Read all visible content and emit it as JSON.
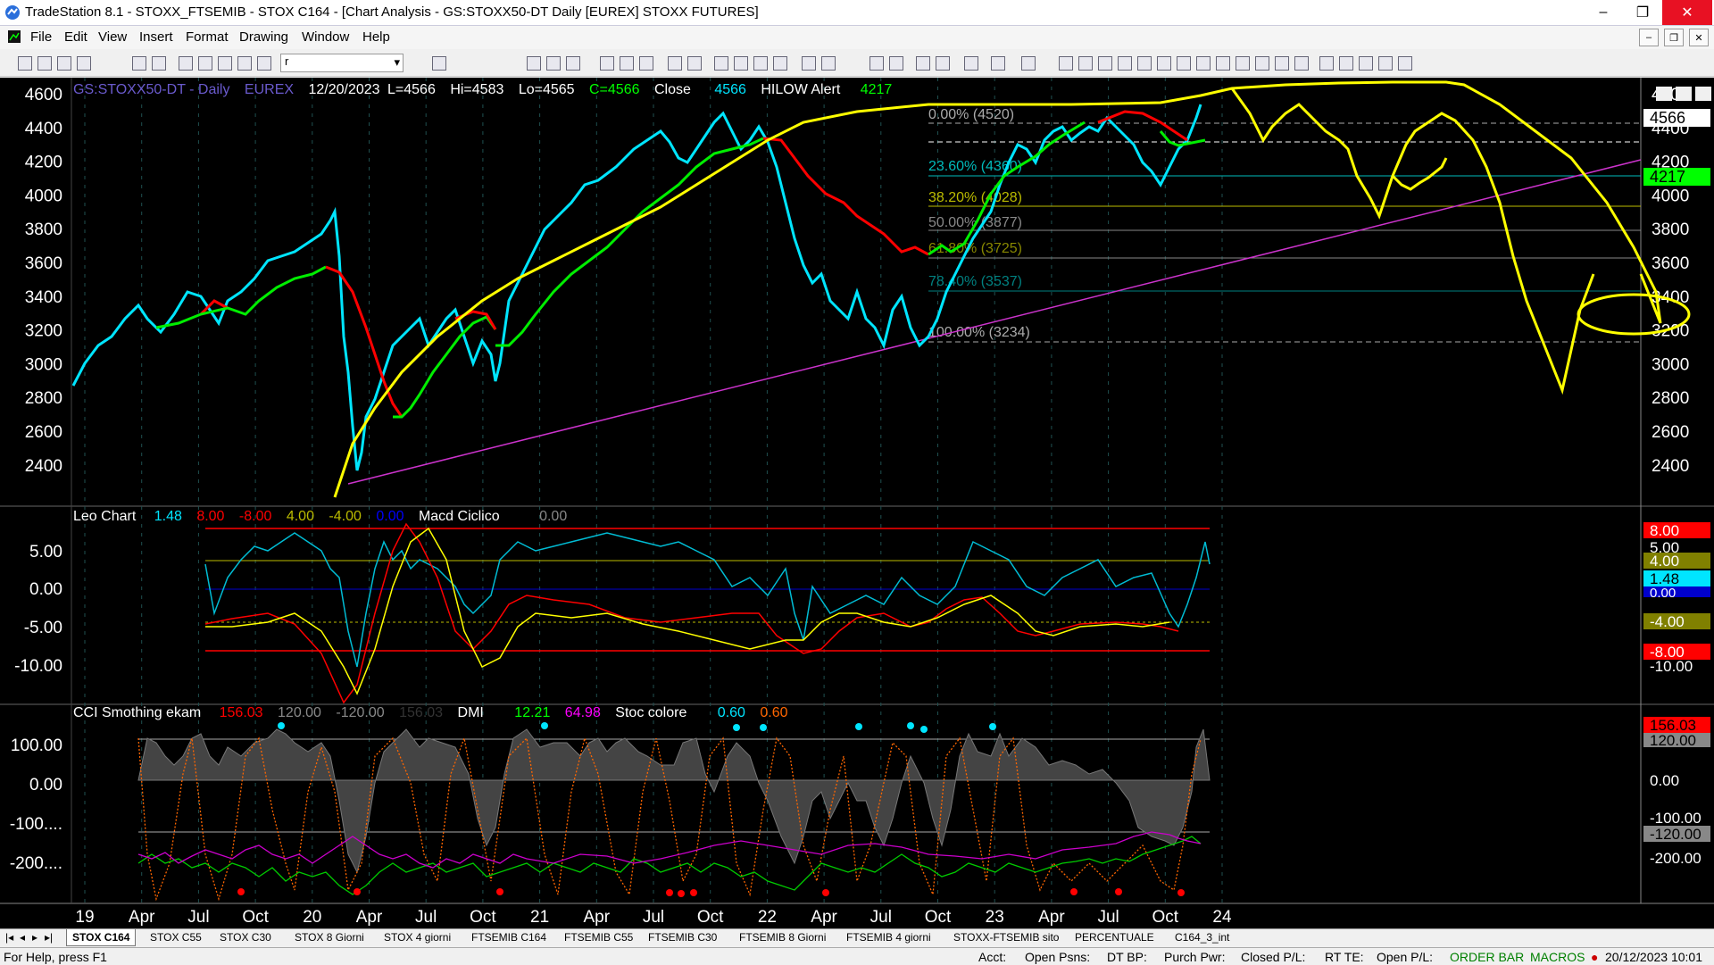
{
  "window": {
    "title": "TradeStation 8.1 - STOXX_FTSEMIB - STOX C164 - [Chart Analysis - GS:STOXX50-DT  Daily  [EUREX] STOXX FUTURES]",
    "minimize": "–",
    "maximize": "❐",
    "close": "✕"
  },
  "menu": [
    "File",
    "Edit",
    "View",
    "Insert",
    "Format",
    "Drawing",
    "Window",
    "Help"
  ],
  "mdi": [
    "–",
    "❐",
    "✕"
  ],
  "toolbar": {
    "symbol_box": "r"
  },
  "chart": {
    "header": {
      "symbol": "GS:STOXX50-DT - Daily",
      "exchange": "EUREX",
      "date": "12/20/2023",
      "last": "L=4566",
      "high": "Hi=4583",
      "low": "Lo=4565",
      "close": "C=4566",
      "close_label": "Close",
      "close_value": "4566",
      "ind_name": "HILOW Alert",
      "ind_value": "4217"
    },
    "price_ticks": [
      "4600",
      "4400",
      "4200",
      "4000",
      "3800",
      "3600",
      "3400",
      "3200",
      "3000",
      "2800",
      "2600",
      "2400"
    ],
    "price_tags": {
      "last": "4566",
      "hilow": "4217"
    },
    "fib_labels": [
      "0.00% (4520)",
      "23.60% (4360)",
      "38.20% (4028)",
      "50.00% (3877)",
      "61.80% (3725)",
      "78.40% (3537)",
      "100.00% (3234)"
    ],
    "leo": {
      "name": "Leo Chart",
      "v1": "1.48",
      "v2": "8.00",
      "v3": "-8.00",
      "v4": "4.00",
      "v5": "-4.00",
      "v6": "0.00",
      "name2": "Macd Ciclico",
      "v7": "0.00",
      "ticks": [
        "5.00",
        "0.00",
        "-5.00",
        "-10.00"
      ],
      "tags": [
        "8.00",
        "5.00",
        "4.00",
        "1.48",
        "0.00",
        "-4.00",
        "-8.00",
        "-10.00"
      ]
    },
    "cci": {
      "name": "CCI Smothing ekam",
      "v1": "156.03",
      "v2": "120.00",
      "v3": "-120.00",
      "v4": "156.03",
      "dmi": "DMI",
      "dmi1": "12.21",
      "dmi2": "64.98",
      "stoc": "Stoc colore",
      "s1": "0.60",
      "s2": "0.60",
      "ticks": [
        "100.00",
        "0.00",
        "-100....",
        "-200...."
      ],
      "tags": [
        "156.03",
        "120.00",
        "0.00",
        "-100.00",
        "-120.00",
        "-200.00"
      ]
    },
    "xaxis": [
      "19",
      "Apr",
      "Jul",
      "Oct",
      "20",
      "Apr",
      "Jul",
      "Oct",
      "21",
      "Apr",
      "Jul",
      "Oct",
      "22",
      "Apr",
      "Jul",
      "Oct",
      "23",
      "Apr",
      "Jul",
      "Oct",
      "24"
    ],
    "colors": {
      "yellow": "#ffff00",
      "red": "#ff0000",
      "green": "#00ff00",
      "cyan": "#00e5ff",
      "magenta": "#cc33cc"
    }
  },
  "tabs": [
    "STOX C164",
    "STOX C55",
    "STOX  C30",
    "STOX  8 Giorni",
    "STOX 4 giorni",
    "FTSEMIB C164",
    "FTSEMIB C55",
    "FTSEMIB C30",
    "FTSEMIB  8 Giorni",
    "FTSEMIB  4 giorni",
    "STOXX-FTSEMIB sito",
    "PERCENTUALE",
    "C164_3_int"
  ],
  "status": {
    "help": "For Help, press F1",
    "acct": "Acct:",
    "open_psns": "Open Psns:",
    "dt_bp": "DT BP:",
    "purch_pwr": "Purch Pwr:",
    "closed_pl": "Closed P/L:",
    "rt_te": "RT TE:",
    "open_pl": "Open P/L:",
    "order_bar": "ORDER BAR",
    "macros": "MACROS",
    "datetime": "20/12/2023 10:01"
  }
}
